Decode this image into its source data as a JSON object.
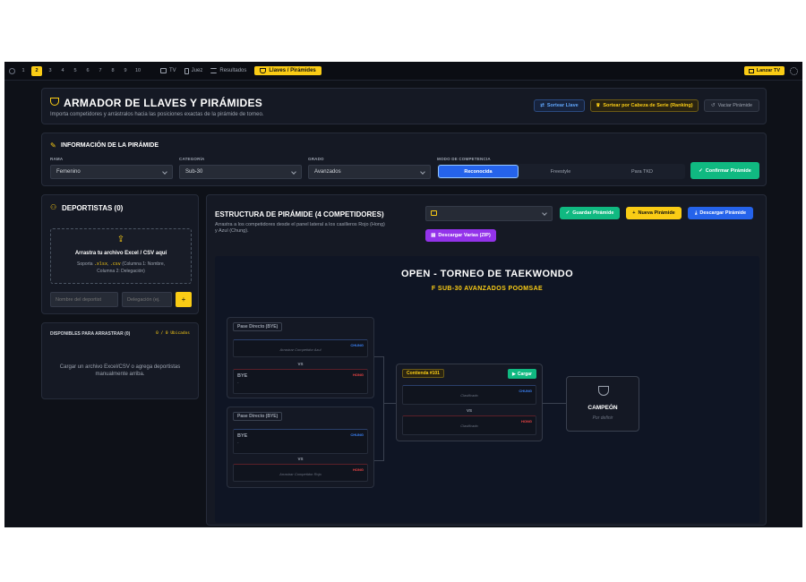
{
  "topbar": {
    "numbers": [
      "1",
      "2",
      "3",
      "4",
      "5",
      "6",
      "7",
      "8",
      "9",
      "10"
    ],
    "active_number": "2",
    "nav": [
      {
        "label": "TV",
        "icon": "monitor-icon"
      },
      {
        "label": "Juez",
        "icon": "phone-icon"
      },
      {
        "label": "Resultados",
        "icon": "list-icon"
      },
      {
        "label": "Llaves / Pirámides",
        "icon": "trophy-icon",
        "active": true
      }
    ],
    "launch_tv": "Lanzar TV"
  },
  "header": {
    "title": "ARMADOR DE LLAVES Y PIRÁMIDES",
    "subtitle": "Importa competidores y arrástralos hacia las posiciones exactas de la pirámide de torneo.",
    "btn_sortear": "Sortear Llave",
    "btn_cabeza": "Sortear por Cabeza de Serie (Ranking)",
    "btn_vaciar": "Vaciar Pirámide"
  },
  "info": {
    "title": "INFORMACIÓN DE LA PIRÁMIDE",
    "rama_label": "RAMA",
    "rama_value": "Femenino",
    "categoria_label": "CATEGORÍA",
    "categoria_value": "Sub-30",
    "grado_label": "GRADO",
    "grado_value": "Avanzados",
    "modo_label": "MODO DE COMPETENCIA",
    "modes": [
      "Reconocida",
      "Freestyle",
      "Para TKD"
    ],
    "active_mode": "Reconocida",
    "confirm": "Confirmar Pirámide"
  },
  "deportistas": {
    "title": "DEPORTISTAS (0)",
    "drop_title": "Arrastra tu archivo Excel / CSV aquí",
    "drop_support_prefix": "Soporta",
    "ext1": ".xlsx",
    "ext2": ".csv",
    "drop_support_suffix": "(Columna 1: Nombre,",
    "drop_support_line2": "Columna 2: Delegación)",
    "name_placeholder": "Nombre del deportist",
    "delegation_placeholder": "Delegación (ej.",
    "available_title": "DISPONIBLES PARA ARRASTRAR (0)",
    "ubicados": "0 / 0 Ubicados",
    "empty_msg_1": "Cargar un archivo Excel/CSV o agrega deportistas",
    "empty_msg_2": "manualmente arriba."
  },
  "structure": {
    "title": "ESTRUCTURA DE PIRÁMIDE (4 COMPETIDORES)",
    "subtitle_1": "Arrastra a los competidores desde el panel lateral a los casilleros Rojo (Hong)",
    "subtitle_2": "y Azul (Chung).",
    "btn_guardar": "Guardar Pirámide",
    "btn_nueva": "Nueva Pirámide",
    "btn_descargar": "Descargar Pirámide",
    "btn_zip": "Descargar Varias (ZIP)"
  },
  "bracket": {
    "title": "OPEN - TORNEO DE TAEKWONDO",
    "subtitle": "F SUB-30 AVANZADOS POOMSAE",
    "m1_head": "Pase Directo (BYE)",
    "m1_blue_ph": "Arrastrar Competidor Azul",
    "m1_red_name": "BYE",
    "m1_red_sub": "-",
    "m2_head": "Pase Directo (BYE)",
    "m2_blue_name": "BYE",
    "m2_blue_sub": "-",
    "m2_red_ph": "Arrastrar Competidor Rojo",
    "m3_head": "Contienda #101",
    "m3_cargar": "Cargar",
    "m3_blue_ph": "Clasificado",
    "m3_red_ph": "Clasificado",
    "chung": "CHUNG",
    "hong": "HONG",
    "vs": "VS",
    "champion": "CAMPEÓN",
    "champion_sub": "Por definir"
  },
  "colors": {
    "accent": "#facc15",
    "green": "#10b981",
    "blue": "#2563eb",
    "purple": "#9333ea",
    "chung": "#3b82f6",
    "hong": "#ef4444"
  }
}
